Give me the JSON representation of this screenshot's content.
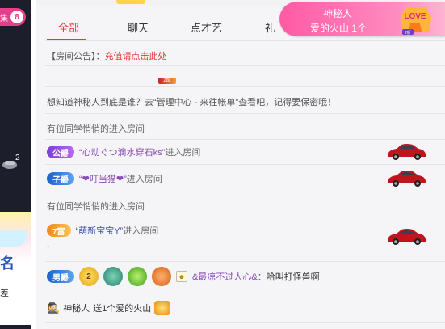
{
  "left_rail": {
    "badge_fragment": "集",
    "badge_count": "8",
    "gift_count": "2",
    "card_big": "名",
    "card_small": "差"
  },
  "tabs": [
    {
      "label": "全部",
      "active": true
    },
    {
      "label": "聊天",
      "active": false
    },
    {
      "label": "点才艺",
      "active": false
    },
    {
      "label": "礼",
      "active": false
    }
  ],
  "announcement": {
    "prefix": "【房间公告】：",
    "link": "充值请点击此处"
  },
  "tiny_badge": "2级",
  "notice": "想知道神秘人到底是谁？去“管理中心 - 来往帐单”查看吧，记得要保密哦！",
  "messages": [
    {
      "type": "text",
      "text": "有位同学悄悄的进入房间"
    },
    {
      "type": "enter",
      "badge": "公爵",
      "badge_style": "gong",
      "name": "“心动ぐつ滴水穿石ks”",
      "suffix": "进入房间",
      "car": true
    },
    {
      "type": "enter",
      "badge": "子爵",
      "badge_style": "zi",
      "name": "“❤叮当猫❤”",
      "suffix": "进入房间",
      "car": true
    },
    {
      "type": "text",
      "text": "有位同学悄悄的进入房间"
    },
    {
      "type": "enter",
      "badge": "7富",
      "badge_style": "fu",
      "name": "“萌新宝宝Y”",
      "suffix": "进入房间",
      "car": true
    }
  ],
  "stray_mark": "`",
  "chat": {
    "badge": "男爵",
    "level": "2",
    "name": "&最凉不过人心&",
    "sep": "：",
    "text": "哈叫打怪兽啊"
  },
  "gift_line": {
    "who": "神秘人",
    "text": "送1个爱的火山"
  },
  "popup": {
    "line1": "神秘人",
    "line2": "爱的火山 1个",
    "gift_tag": "LOVE",
    "gift_level": "2折"
  },
  "colors": {
    "accent": "#e53935",
    "popup_pink": "#ff5aa5",
    "rail": "#1c1f2b"
  }
}
